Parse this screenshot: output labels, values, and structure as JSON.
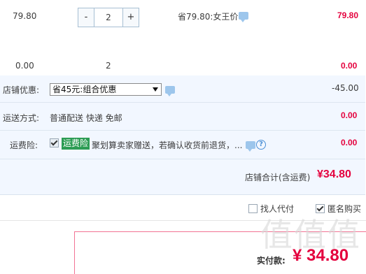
{
  "item_row": {
    "unit_price": "79.80",
    "decrement_label": "-",
    "quantity": "2",
    "increment_label": "+",
    "promo_text": "省79.80:女王价",
    "subtotal": "79.80"
  },
  "summary_row": {
    "unit_price": "0.00",
    "quantity": "2",
    "subtotal": "0.00"
  },
  "shop_discount": {
    "label": "店铺优惠:",
    "selected_option": "省45元:组合优惠",
    "amount": "-45.00"
  },
  "shipping": {
    "label": "运送方式:",
    "text": "普通配送 快递 免邮",
    "amount": "0.00"
  },
  "insurance": {
    "label": "运费险:",
    "tag": "运费险",
    "text": "聚划算卖家赠送，若确认收货前退货，...",
    "amount": "0.00"
  },
  "shop_total": {
    "label": "店铺合计(含运费)",
    "amount": "¥34.80"
  },
  "options": {
    "proxy_pay_label": "找人代付",
    "anonymous_label": "匿名购买"
  },
  "payment": {
    "label": "实付款:",
    "amount": "¥ 34.80"
  },
  "watermark_text": "值值值",
  "colors": {
    "price_red": "#e4023e",
    "panel_bg": "#f2f7ff",
    "tag_green": "#2c9c54"
  }
}
